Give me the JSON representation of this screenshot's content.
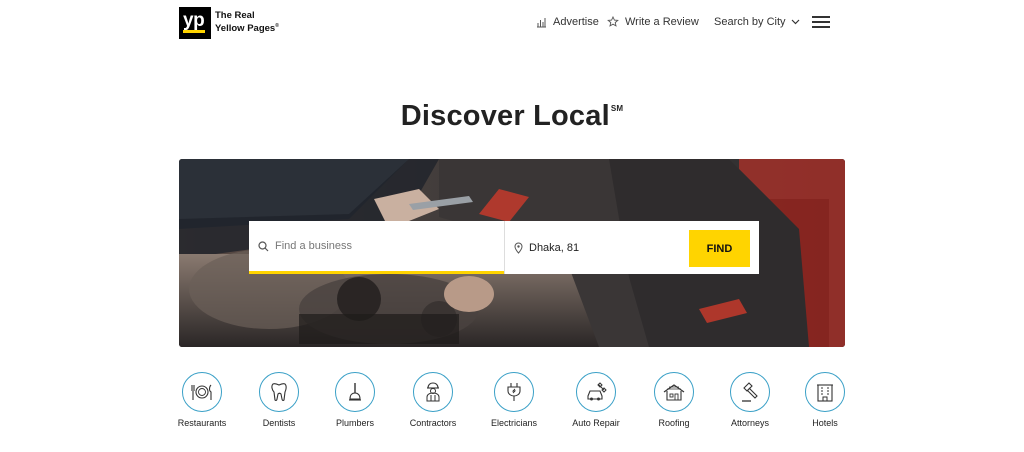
{
  "header": {
    "logo": {
      "mark": "yp",
      "line1": "The Real",
      "line2": "Yellow Pages",
      "reg": "®"
    },
    "nav": {
      "advertise": {
        "label": "Advertise",
        "icon": "bar-chart-icon"
      },
      "write_review": {
        "label": "Write a Review",
        "icon": "star-icon"
      },
      "search_by_city": {
        "label": "Search by City",
        "icon": "chevron-down-icon"
      },
      "menu": {
        "icon": "hamburger-menu-icon"
      }
    }
  },
  "main": {
    "title": "Discover Local",
    "title_mark": "SM"
  },
  "search": {
    "what": {
      "placeholder": "Find a business",
      "value": "",
      "icon": "search-icon"
    },
    "where": {
      "value": "Dhaka, 81",
      "icon": "location-pin-icon"
    },
    "find_label": "FIND"
  },
  "categories": [
    {
      "label": "Restaurants",
      "icon": "plate-utensils-icon"
    },
    {
      "label": "Dentists",
      "icon": "tooth-icon"
    },
    {
      "label": "Plumbers",
      "icon": "plunger-icon"
    },
    {
      "label": "Contractors",
      "icon": "worker-icon"
    },
    {
      "label": "Electricians",
      "icon": "plug-icon"
    },
    {
      "label": "Auto Repair",
      "icon": "car-wrench-icon"
    },
    {
      "label": "Roofing",
      "icon": "house-roof-icon"
    },
    {
      "label": "Attorneys",
      "icon": "gavel-icon"
    },
    {
      "label": "Hotels",
      "icon": "hotel-building-icon"
    }
  ],
  "colors": {
    "brand_yellow": "#ffd400",
    "icon_blue": "#3aa0c7",
    "text_dark": "#222222"
  }
}
